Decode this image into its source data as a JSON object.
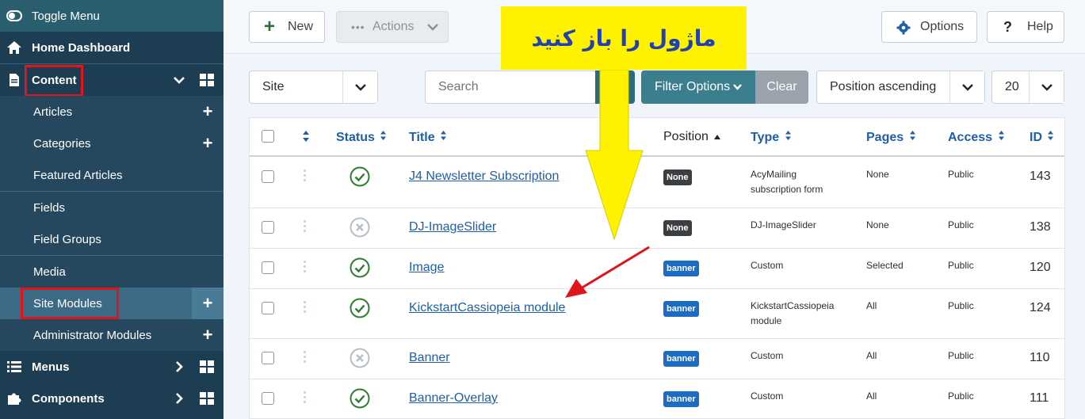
{
  "sidebar": {
    "toggle_label": "Toggle Menu",
    "home_label": "Home Dashboard",
    "content_label": "Content",
    "items": [
      {
        "label": "Articles",
        "plus": "+"
      },
      {
        "label": "Categories",
        "plus": "+"
      },
      {
        "label": "Featured Articles",
        "plus": ""
      },
      {
        "label": "Fields",
        "plus": ""
      },
      {
        "label": "Field Groups",
        "plus": ""
      },
      {
        "label": "Media",
        "plus": ""
      },
      {
        "label": "Site Modules",
        "plus": "+"
      },
      {
        "label": "Administrator Modules",
        "plus": "+"
      }
    ],
    "menus_label": "Menus",
    "components_label": "Components"
  },
  "toolbar": {
    "new_label": "New",
    "actions_label": "Actions",
    "options_label": "Options",
    "help_label": "Help"
  },
  "filters": {
    "client_value": "Site",
    "search_placeholder": "Search",
    "filter_options_label": "Filter Options",
    "clear_label": "Clear",
    "ordering_value": "Position ascending",
    "limit_value": "20"
  },
  "table": {
    "headers": {
      "status": "Status",
      "title": "Title",
      "position": "Position",
      "type": "Type",
      "pages": "Pages",
      "access": "Access",
      "id": "ID"
    },
    "rows": [
      {
        "status": "published",
        "title": "J4 Newsletter Subscription",
        "position": "None",
        "type1": "AcyMailing",
        "type2": "subscription form",
        "pages": "None",
        "access": "Public",
        "id": "143"
      },
      {
        "status": "unpublished",
        "title": "DJ-ImageSlider",
        "position": "None",
        "type1": "DJ-ImageSlider",
        "type2": "",
        "pages": "None",
        "access": "Public",
        "id": "138"
      },
      {
        "status": "published",
        "title": "Image",
        "position": "banner",
        "type1": "Custom",
        "type2": "",
        "pages": "Selected",
        "access": "Public",
        "id": "120"
      },
      {
        "status": "published",
        "title": "KickstartCassiopeia module",
        "position": "banner",
        "type1": "KickstartCassiopeia",
        "type2": "module",
        "pages": "All",
        "access": "Public",
        "id": "124"
      },
      {
        "status": "unpublished",
        "title": "Banner",
        "position": "banner",
        "type1": "Custom",
        "type2": "",
        "pages": "All",
        "access": "Public",
        "id": "110"
      },
      {
        "status": "published",
        "title": "Banner-Overlay",
        "position": "banner",
        "type1": "Custom",
        "type2": "",
        "pages": "All",
        "access": "Public",
        "id": "111"
      }
    ]
  },
  "annotation": {
    "note": "ماژول را باز کنید"
  },
  "colors": {
    "sidebar_bg": "#1c3d52",
    "accent": "#1f5ea8",
    "published": "#2f7d32",
    "highlight_yellow": "#fff200",
    "annotation_red": "#e0141b"
  }
}
